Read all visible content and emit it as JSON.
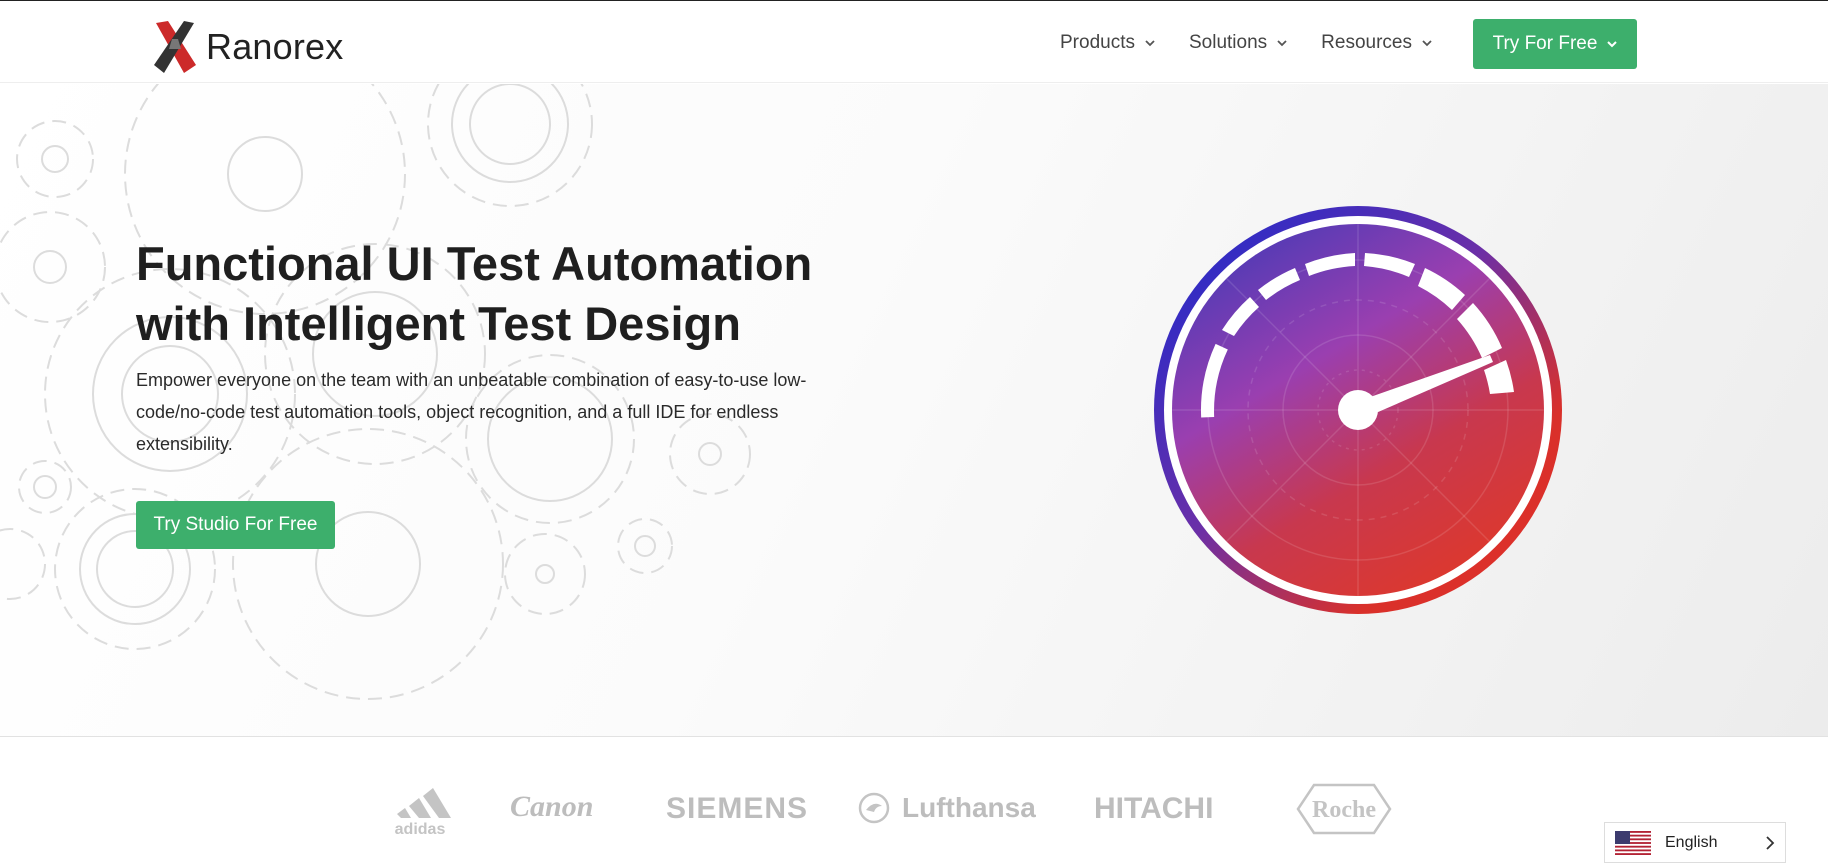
{
  "brand": {
    "name": "Ranorex",
    "accent": "#3daf6c"
  },
  "nav": {
    "items": [
      {
        "label": "Products"
      },
      {
        "label": "Solutions"
      },
      {
        "label": "Resources"
      }
    ],
    "cta": "Try For Free"
  },
  "hero": {
    "title_line1": "Functional UI Test Automation",
    "title_line2": "with Intelligent Test Design",
    "description": "Empower everyone on the team with an unbeatable combination of easy-to-use low-code/no-code test automation tools, object recognition, and a full IDE for endless extensibility.",
    "cta": "Try Studio For Free"
  },
  "customers": {
    "logos": [
      "adidas",
      "Canon",
      "SIEMENS",
      "Lufthansa",
      "HITACHI",
      "Roche"
    ]
  },
  "language": {
    "label": "English",
    "flag": "us-flag-icon"
  }
}
